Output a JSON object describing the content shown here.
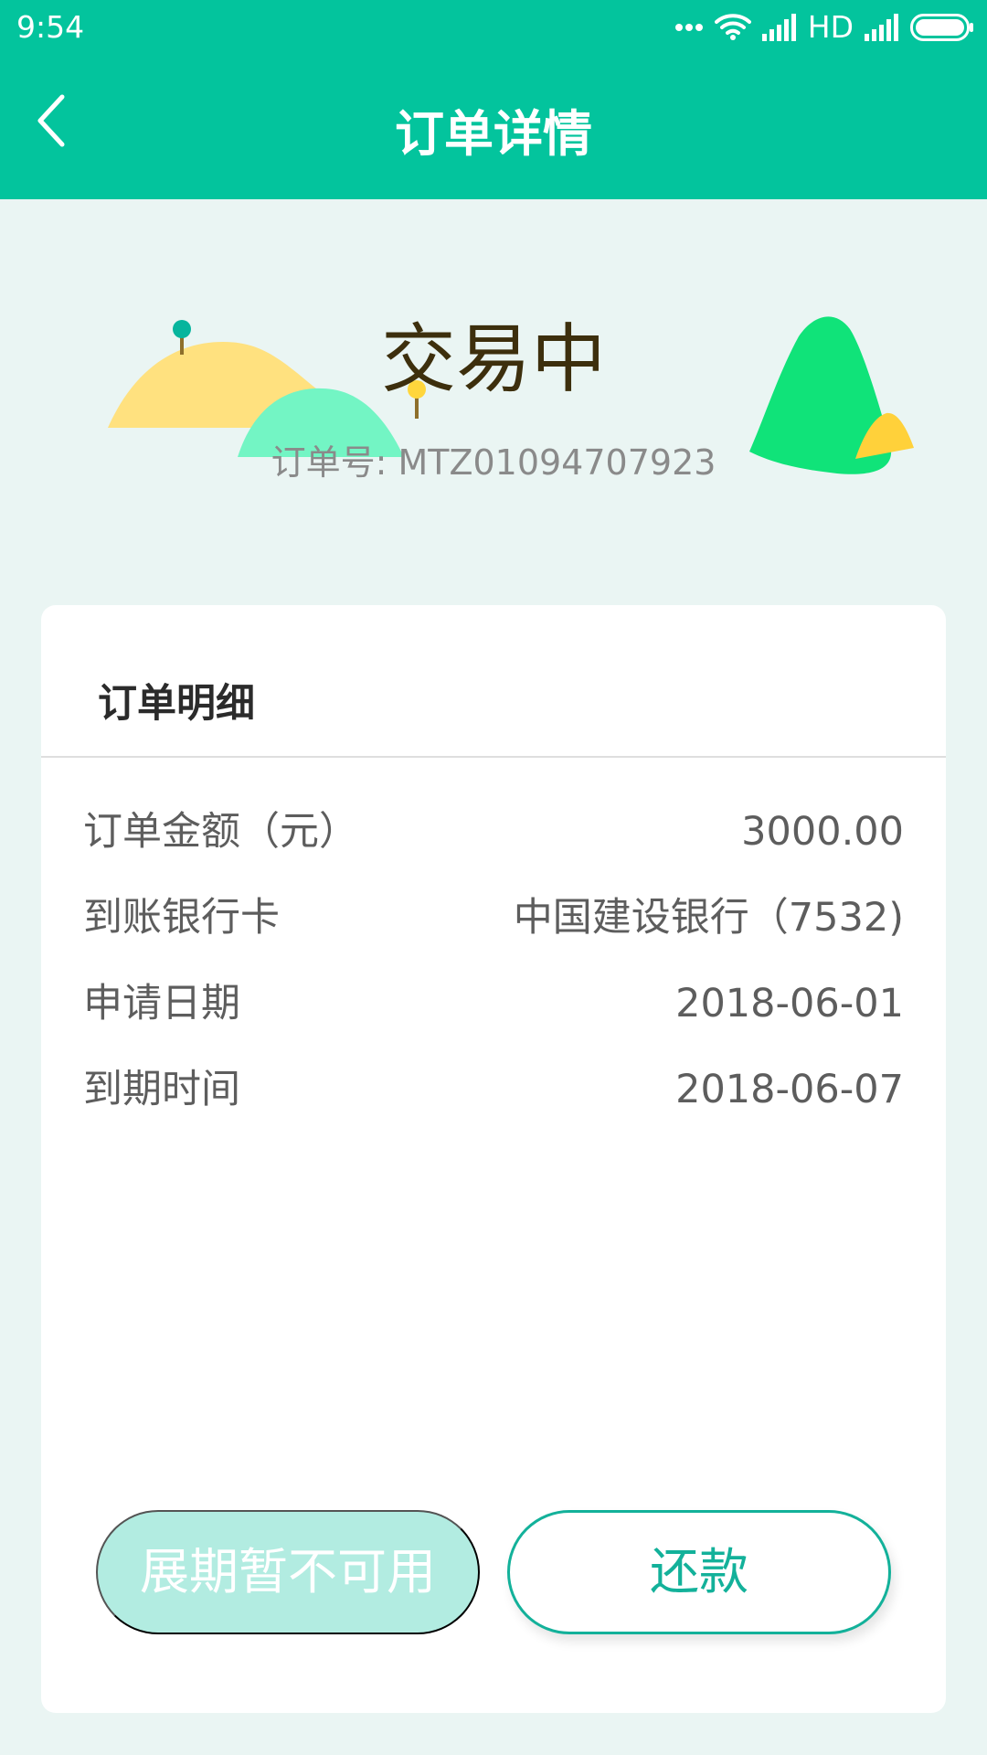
{
  "status_bar": {
    "time": "9:54",
    "network": "HD",
    "icons": [
      "more-dots-icon",
      "wifi-icon",
      "signal-icon",
      "signal-icon-2",
      "battery-icon"
    ]
  },
  "header": {
    "title": "订单详情",
    "back_icon": "back-chevron-icon"
  },
  "hero": {
    "status": "交易中",
    "order_number": "订单号: MTZ01094707923"
  },
  "order_detail": {
    "title": "订单明细",
    "rows": [
      {
        "label": "订单金额（元）",
        "value": "3000.00"
      },
      {
        "label": "到账银行卡",
        "value": "中国建设银行（7532)"
      },
      {
        "label": "申请日期",
        "value": "2018-06-01"
      },
      {
        "label": "到期时间",
        "value": "2018-06-07"
      }
    ]
  },
  "actions": {
    "extend_label": "展期暂不可用",
    "repay_label": "还款"
  },
  "colors": {
    "brand": "#03c49d",
    "background": "#eaf5f3",
    "repay_border": "#13b19a",
    "extend_disabled": "#b2ece1"
  }
}
